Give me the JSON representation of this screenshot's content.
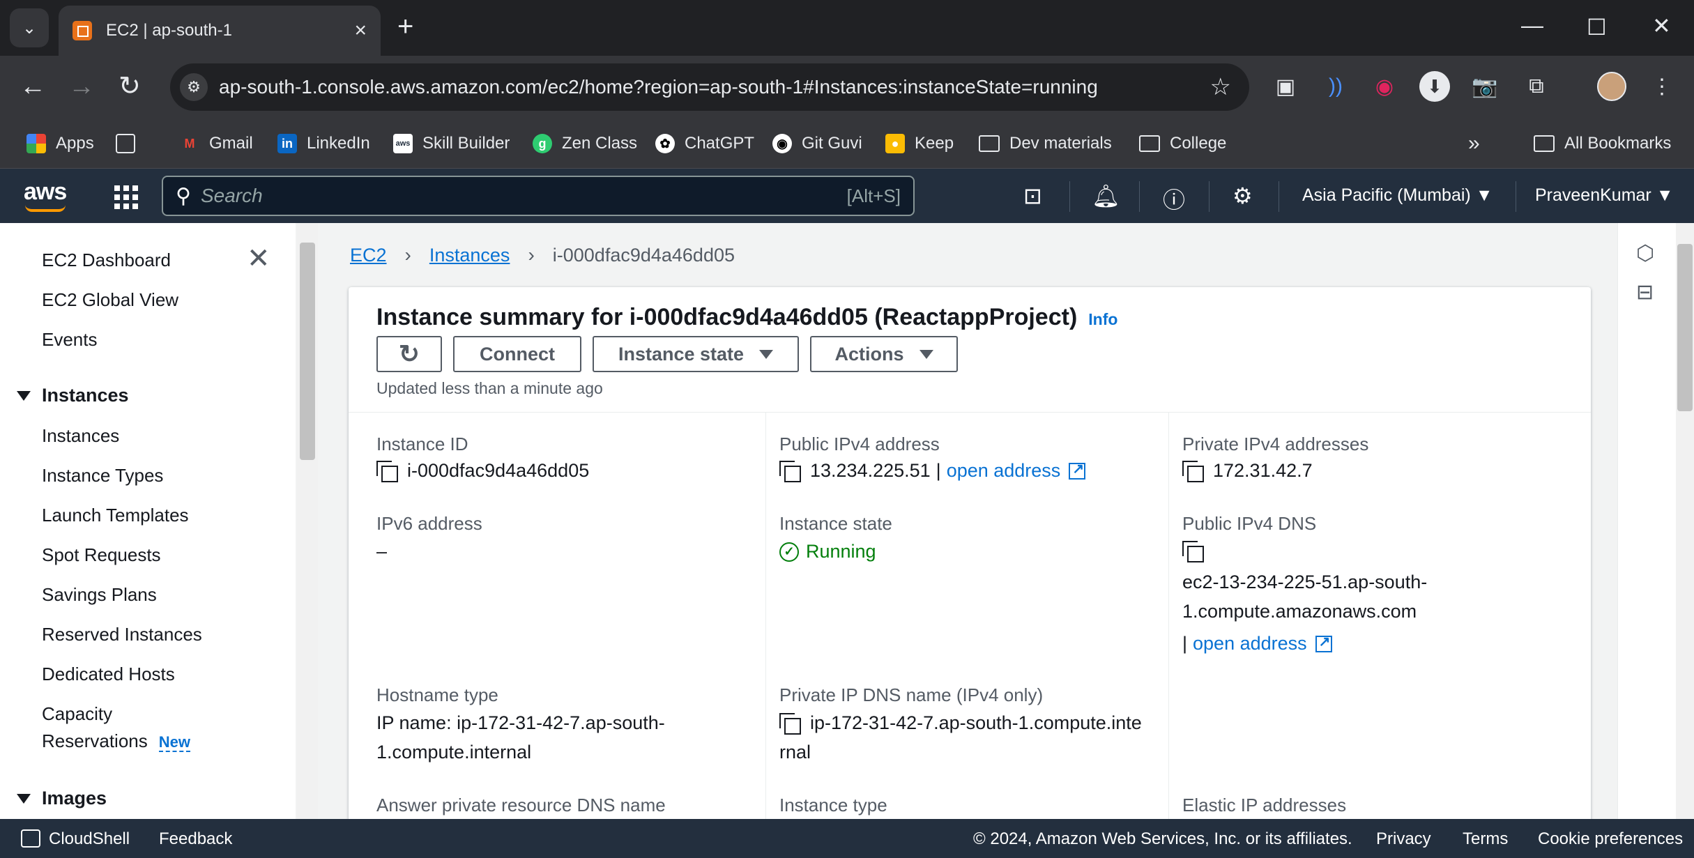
{
  "browser": {
    "tab_title": "EC2 | ap-south-1",
    "url": "ap-south-1.console.aws.amazon.com/ec2/home?region=ap-south-1#Instances:instanceState=running",
    "bookmarks": [
      "Apps",
      "Gmail",
      "LinkedIn",
      "Skill Builder",
      "Zen Class",
      "ChatGPT",
      "Git Guvi",
      "Keep",
      "Dev materials",
      "College"
    ],
    "all_bookmarks": "All Bookmarks"
  },
  "aws_header": {
    "logo": "aws",
    "search_placeholder": "Search",
    "search_hint": "[Alt+S]",
    "region": "Asia Pacific (Mumbai)",
    "user": "PraveenKumar"
  },
  "sidenav": {
    "top_items": [
      "EC2 Dashboard",
      "EC2 Global View",
      "Events"
    ],
    "instances_header": "Instances",
    "instances_items": [
      "Instances",
      "Instance Types",
      "Launch Templates",
      "Spot Requests",
      "Savings Plans",
      "Reserved Instances",
      "Dedicated Hosts"
    ],
    "capacity_line1": "Capacity",
    "capacity_line2": "Reservations",
    "new_badge": "New",
    "images_header": "Images"
  },
  "breadcrumb": {
    "ec2": "EC2",
    "instances": "Instances",
    "current": "i-000dfac9d4a46dd05"
  },
  "summary": {
    "title": "Instance summary for i-000dfac9d4a46dd05 (ReactappProject)",
    "info": "Info",
    "connect": "Connect",
    "instance_state": "Instance state",
    "actions": "Actions",
    "updated": "Updated less than a minute ago"
  },
  "details": {
    "instance_id_label": "Instance ID",
    "instance_id": "i-000dfac9d4a46dd05",
    "public_ipv4_label": "Public IPv4 address",
    "public_ipv4": "13.234.225.51",
    "open_address": "open address",
    "private_ipv4_label": "Private IPv4 addresses",
    "private_ipv4": "172.31.42.7",
    "ipv6_label": "IPv6 address",
    "ipv6": "–",
    "state_label": "Instance state",
    "state": "Running",
    "public_dns_label": "Public IPv4 DNS",
    "public_dns_line1": "ec2-13-234-225-51.ap-south-",
    "public_dns_line2": "1.compute.amazonaws.com",
    "hostname_type_label": "Hostname type",
    "hostname_line1": "IP name: ip-172-31-42-7.ap-south-",
    "hostname_line2": "1.compute.internal",
    "private_dns_label": "Private IP DNS name (IPv4 only)",
    "private_dns_line1": "ip-172-31-42-7.ap-south-1.compute.inte",
    "private_dns_line2": "rnal",
    "answer_dns_label": "Answer private resource DNS name",
    "instance_type_label": "Instance type",
    "elastic_ip_label": "Elastic IP addresses"
  },
  "footer": {
    "cloudshell": "CloudShell",
    "feedback": "Feedback",
    "copyright": "© 2024, Amazon Web Services, Inc. or its affiliates.",
    "privacy": "Privacy",
    "terms": "Terms",
    "cookies": "Cookie preferences"
  }
}
